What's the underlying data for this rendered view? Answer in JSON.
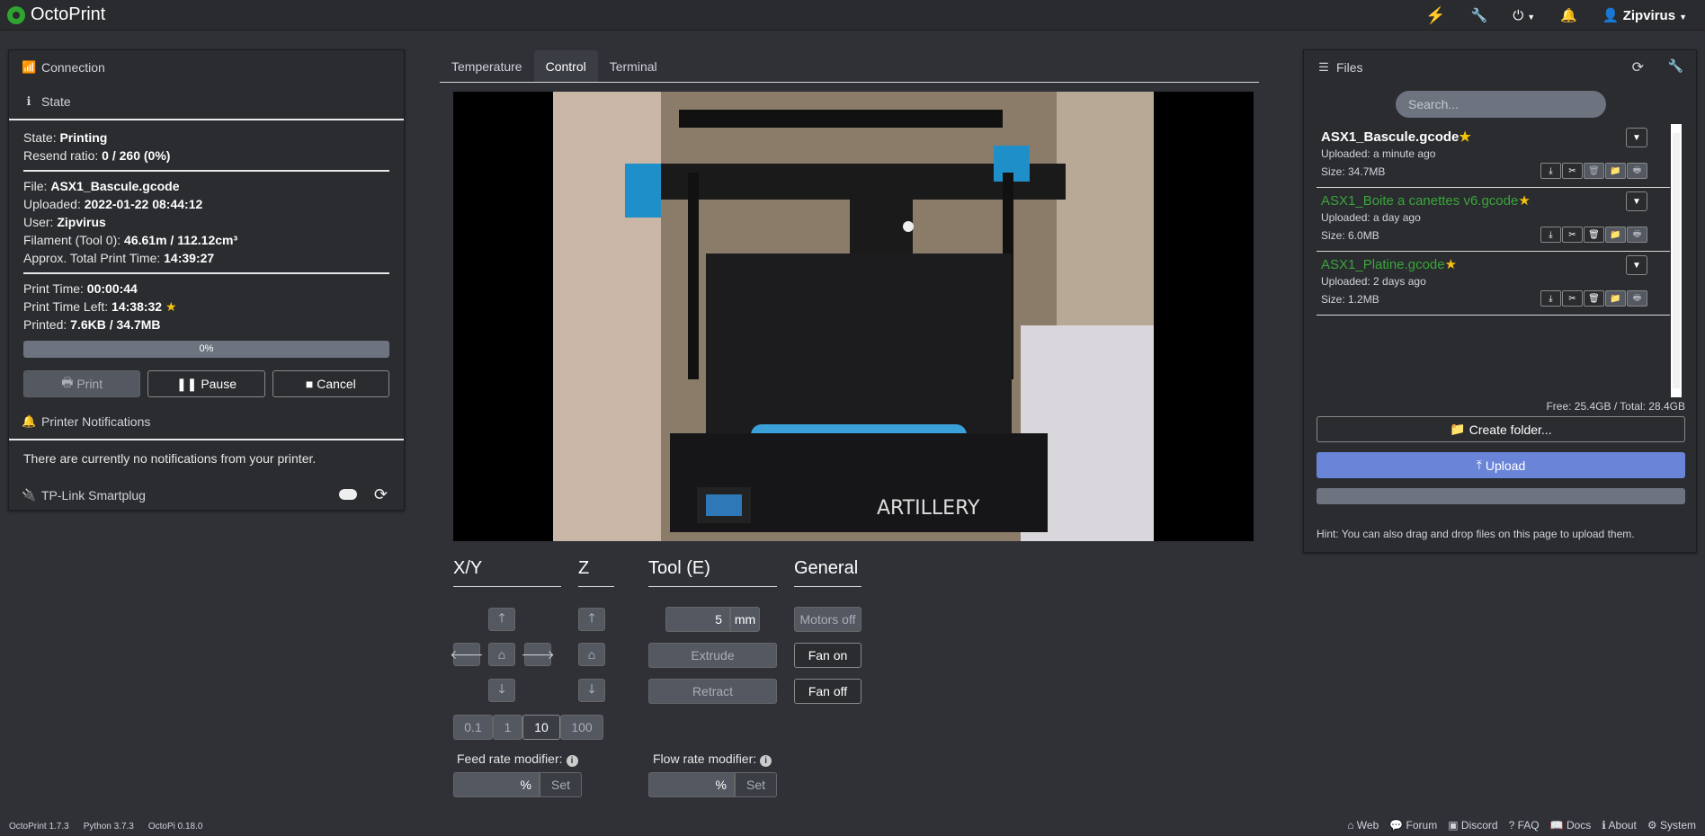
{
  "navbar": {
    "brand": "OctoPrint",
    "user": "Zipvirus"
  },
  "connection": {
    "title": "Connection"
  },
  "state": {
    "title": "State",
    "state_label": "State: ",
    "state_value": "Printing",
    "resend_label": "Resend ratio: ",
    "resend_value": "0 / 260 (0%)",
    "file_label": "File: ",
    "file_value": "ASX1_Bascule.gcode",
    "uploaded_label": "Uploaded: ",
    "uploaded_value": "2022-01-22 08:44:12",
    "user_label": "User: ",
    "user_value": "Zipvirus",
    "filament_label": "Filament (Tool 0): ",
    "filament_value": "46.61m / 112.12cm³",
    "approx_label": "Approx. Total Print Time: ",
    "approx_value": "14:39:27",
    "printtime_label": "Print Time: ",
    "printtime_value": "00:00:44",
    "timeleft_label": "Print Time Left: ",
    "timeleft_value": "14:38:32",
    "printed_label": "Printed: ",
    "printed_value": "7.6KB / 34.7MB",
    "progress_text": "0%",
    "progress_fraction": 0.0,
    "print_button": "Print",
    "pause_button": "Pause",
    "cancel_button": "Cancel"
  },
  "notifications": {
    "title": "Printer Notifications",
    "text": "There are currently no notifications from your printer."
  },
  "smartplug": {
    "title": "TP-Link Smartplug"
  },
  "tabs": [
    "Temperature",
    "Control",
    "Terminal"
  ],
  "control": {
    "xy_title": "X/Y",
    "z_title": "Z",
    "tool_title": "Tool (E)",
    "general_title": "General",
    "steps": [
      "0.1",
      "1",
      "10",
      "100"
    ],
    "extrude_amount": "5",
    "extrude_unit": "mm",
    "extrude_button": "Extrude",
    "retract_button": "Retract",
    "motors_off": "Motors off",
    "fan_on": "Fan on",
    "fan_off": "Fan off",
    "feed_label": "Feed rate modifier:",
    "flow_label": "Flow rate modifier:",
    "percent": "%",
    "set": "Set"
  },
  "files": {
    "title": "Files",
    "search_placeholder": "Search...",
    "items": [
      {
        "name": "ASX1_Bascule.gcode",
        "uploaded": "Uploaded: a minute ago",
        "size": "Size: 34.7MB",
        "color": "#ffffff"
      },
      {
        "name": "ASX1_Boite a canettes v6.gcode",
        "uploaded": "Uploaded: a day ago",
        "size": "Size: 6.0MB",
        "color": "#3aa53a"
      },
      {
        "name": "ASX1_Platine.gcode",
        "uploaded": "Uploaded: 2 days ago",
        "size": "Size: 1.2MB",
        "color": "#3aa53a"
      }
    ],
    "free": "Free: 25.4GB / Total: 28.4GB",
    "create_folder": "Create folder...",
    "upload": "Upload",
    "hint": "Hint: You can also drag and drop files on this page to upload them."
  },
  "footer": {
    "versions": [
      "OctoPrint 1.7.3",
      "Python 3.7.3",
      "OctoPi 0.18.0"
    ],
    "links": [
      "Web",
      "Forum",
      "Discord",
      "FAQ",
      "Docs",
      "About",
      "System"
    ]
  }
}
